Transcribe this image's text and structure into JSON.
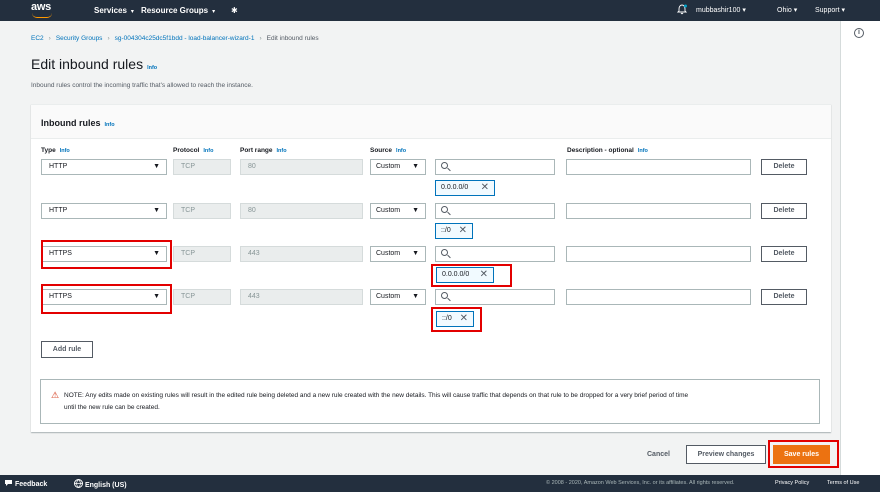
{
  "topnav": {
    "logo_text": "aws",
    "services": "Services",
    "resource_groups": "Resource Groups",
    "pin": "✱",
    "bell": "🔔",
    "user": "mubbashir100",
    "region": "Ohio",
    "support": "Support",
    "caret": "▾"
  },
  "breadcrumb": {
    "items": [
      "EC2",
      "Security Groups",
      "sg-004304c25dc5f1bdd - load-balancer-wizard-1"
    ],
    "current": "Edit inbound rules",
    "separator": "›"
  },
  "page": {
    "title": "Edit inbound rules",
    "info": "Info",
    "description": "Inbound rules control the incoming traffic that's allowed to reach the instance."
  },
  "panel": {
    "title": "Inbound rules",
    "info": "Info",
    "columns": {
      "type": "Type",
      "protocol": "Protocol",
      "port_range": "Port range",
      "source": "Source",
      "description": "Description - optional"
    },
    "rules": [
      {
        "type": "HTTP",
        "protocol": "TCP",
        "port": "80",
        "source": "Custom",
        "token": "0.0.0.0/0",
        "delete": "Delete"
      },
      {
        "type": "HTTP",
        "protocol": "TCP",
        "port": "80",
        "source": "Custom",
        "token": "::/0",
        "delete": "Delete"
      },
      {
        "type": "HTTPS",
        "protocol": "TCP",
        "port": "443",
        "source": "Custom",
        "token": "0.0.0.0/0",
        "delete": "Delete"
      },
      {
        "type": "HTTPS",
        "protocol": "TCP",
        "port": "443",
        "source": "Custom",
        "token": "::/0",
        "delete": "Delete"
      }
    ],
    "add_rule": "Add rule",
    "note_line1": "NOTE: Any edits made on existing rules will result in the edited rule being deleted and a new rule created with the new details. This will cause traffic that depends on that rule to be dropped for a very brief period of time",
    "note_line2": "until the new rule can be created."
  },
  "actions": {
    "cancel": "Cancel",
    "preview": "Preview changes",
    "save": "Save rules"
  },
  "bottombar": {
    "feedback": "Feedback",
    "language": "English (US)",
    "copyright": "© 2008 - 2020, Amazon Web Services, Inc. or its affiliates. All rights reserved.",
    "privacy": "Privacy Policy",
    "terms": "Terms of Use"
  },
  "colors": {
    "nav_bg": "#232f3e",
    "link": "#0073bb",
    "primary": "#ec7211",
    "highlight": "#e30000"
  }
}
